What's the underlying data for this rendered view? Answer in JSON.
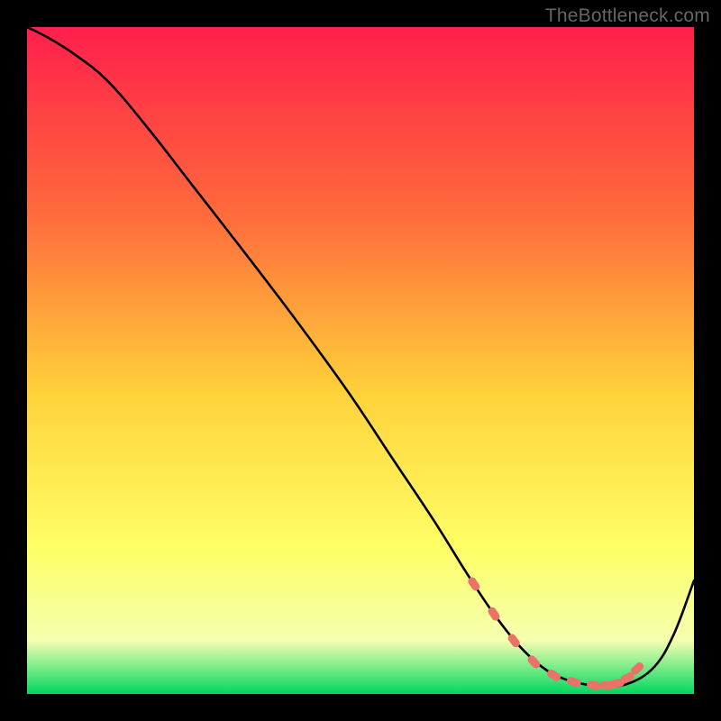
{
  "watermark": "TheBottleneck.com",
  "colors": {
    "gradient_top": "#ff1f4b",
    "gradient_mid1": "#ff6a3c",
    "gradient_mid2": "#ffd23a",
    "gradient_mid3": "#ffff66",
    "gradient_mid4": "#f4ffb0",
    "gradient_bottom": "#00d760",
    "curve": "#000000",
    "marker": "#e97366",
    "frame": "#000000"
  },
  "chart_data": {
    "type": "line",
    "title": "",
    "xlabel": "",
    "ylabel": "",
    "xlim": [
      0,
      100
    ],
    "ylim": [
      0,
      100
    ],
    "series": [
      {
        "name": "bottleneck-curve",
        "x": [
          0,
          3,
          7,
          12,
          18,
          25,
          32,
          40,
          48,
          55,
          61,
          66,
          70,
          74,
          78,
          82,
          86,
          90,
          94,
          97,
          100
        ],
        "y": [
          100,
          98.5,
          96,
          92,
          85,
          76,
          67,
          56.5,
          45.5,
          35,
          26,
          18,
          12,
          7,
          3.5,
          1.8,
          1.2,
          1.5,
          4,
          9,
          17
        ]
      }
    ],
    "markers": {
      "name": "highlight-segment",
      "x": [
        67,
        70,
        73,
        76,
        79,
        82,
        85,
        87,
        88.5,
        90,
        91.5
      ],
      "y": [
        16.5,
        12,
        8,
        4.8,
        2.8,
        1.8,
        1.3,
        1.3,
        1.6,
        2.4,
        3.8
      ]
    }
  }
}
